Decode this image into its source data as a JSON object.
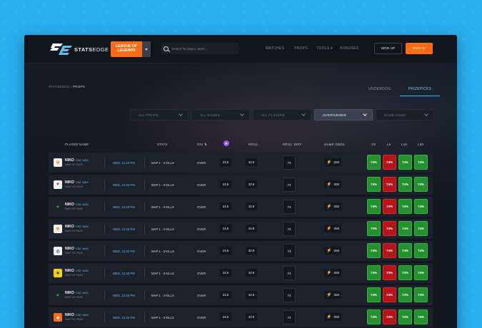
{
  "brand": {
    "name_bold": "STATS",
    "name_light": "EDGE"
  },
  "game_select": {
    "line1": "LEAGUE OF",
    "line2": "LEGENDS"
  },
  "search": {
    "placeholder": "Search for player, team..."
  },
  "nav": {
    "matches": "MATCHES",
    "props": "PROPS",
    "tools": "TOOLS ▾",
    "bonuses": "BONUSES"
  },
  "auth": {
    "signup": "SIGN UP",
    "signin": "SIGN IN"
  },
  "breadcrumb": {
    "root": "STATSEDGE",
    "sep": "/",
    "current": "PROPS"
  },
  "tabs": {
    "underdog": "UNDERDOG",
    "prizepicks": "PRIZEPICKS"
  },
  "filters": [
    "ALL PROPS",
    "ALL GAMES",
    "ALL PLAYERS",
    "OVER/UNDER",
    "GAME ODDS"
  ],
  "headers": {
    "player": "PLAYER NAME",
    "stats": "STATS",
    "ou": "O/U ⇅",
    "pp": "P",
    "proj": "PROJ.",
    "diff": "PROJ. DIFF",
    "odds": "GAME ODDS",
    "vs": "VS",
    "l5": "L5",
    "l10": "L10",
    "l30": "L30"
  },
  "rows": [
    {
      "logo": "navi",
      "name": "NIKO",
      "teams": "C9Z, NAVI",
      "match": "NAVI VS FAZE",
      "time": "WED, 12:20 PM",
      "stat": "MAP 1 - 3 KILLS",
      "ou": "OVER",
      "pp": "24.5",
      "proj": "32.9",
      "diff": "74",
      "odds": "-250",
      "hits": [
        "74%",
        "74%",
        "74%",
        "74%"
      ],
      "hit_colors": [
        "green",
        "red",
        "green",
        "green"
      ]
    },
    {
      "logo": "red",
      "name": "NIKO",
      "teams": "C9Z, NAVI",
      "match": "NAVI VS FAZE",
      "time": "WED, 12:20 PM",
      "stat": "MAP 1 - 3 KILLS",
      "ou": "OVER",
      "pp": "24.5",
      "proj": "32.9",
      "diff": "74",
      "odds": "-250",
      "hits": [
        "74%",
        "74%",
        "74%",
        "74%"
      ],
      "hit_colors": [
        "green",
        "red",
        "green",
        "green"
      ]
    },
    {
      "logo": "green",
      "name": "NIKO",
      "teams": "C9Z, NAVI",
      "match": "NAVI VS FAZE",
      "time": "WED, 12:20 PM",
      "stat": "MAP 1 - 3 KILLS",
      "ou": "OVER",
      "pp": "24.5",
      "proj": "32.9",
      "diff": "74",
      "odds": "-250",
      "hits": [
        "74%",
        "74%",
        "74%",
        "74%"
      ],
      "hit_colors": [
        "green",
        "red",
        "green",
        "green"
      ]
    },
    {
      "logo": "navi",
      "name": "NIKO",
      "teams": "C9Z, NAVI",
      "match": "NAVI VS FAZE",
      "time": "WED, 12:20 PM",
      "stat": "MAP 1 - 3 KILLS",
      "ou": "OVER",
      "pp": "24.5",
      "proj": "32.9",
      "diff": "74",
      "odds": "-250",
      "hits": [
        "74%",
        "74%",
        "74%",
        "74%"
      ],
      "hit_colors": [
        "green",
        "red",
        "green",
        "green"
      ]
    },
    {
      "logo": "purple",
      "name": "NIKO",
      "teams": "C9Z, NAVI",
      "match": "NAVI VS FAZE",
      "time": "WED, 12:20 PM",
      "stat": "MAP 1 - 3 KILLS",
      "ou": "OVER",
      "pp": "24.5",
      "proj": "32.9",
      "diff": "74",
      "odds": "-250",
      "hits": [
        "74%",
        "74%",
        "74%",
        "74%"
      ],
      "hit_colors": [
        "green",
        "red",
        "green",
        "green"
      ]
    },
    {
      "logo": "yellow",
      "name": "NIKO",
      "teams": "C9Z, NAVI",
      "match": "NAVI VS FAZE",
      "time": "WED, 12:20 PM",
      "stat": "MAP 1 - 3 KILLS",
      "ou": "OVER",
      "pp": "24.5",
      "proj": "32.9",
      "diff": "74",
      "odds": "-250",
      "hits": [
        "74%",
        "74%",
        "74%",
        "74%"
      ],
      "hit_colors": [
        "green",
        "red",
        "green",
        "green"
      ]
    },
    {
      "logo": "green",
      "name": "NIKO",
      "teams": "C9Z, NAVI",
      "match": "NAVI VS FAZE",
      "time": "WED, 12:20 PM",
      "stat": "MAP 1 - 3 KILLS",
      "ou": "OVER",
      "pp": "24.5",
      "proj": "32.9",
      "diff": "74",
      "odds": "-250",
      "hits": [
        "74%",
        "74%",
        "74%",
        "74%"
      ],
      "hit_colors": [
        "green",
        "red",
        "green",
        "green"
      ]
    },
    {
      "logo": "orange",
      "name": "NIKO",
      "teams": "C9Z, NAVI",
      "match": "NAVI VS FAZE",
      "time": "WED, 12:20 PM",
      "stat": "MAP 1 - 3 KILLS",
      "ou": "OVER",
      "pp": "24.5",
      "proj": "32.9",
      "diff": "74",
      "odds": "-250",
      "hits": [
        "74%",
        "74%",
        "74%",
        "74%"
      ],
      "hit_colors": [
        "green",
        "red",
        "green",
        "green"
      ]
    }
  ],
  "colors": {
    "accent": "#ff6a13",
    "link": "#5fbdf0",
    "hit_green": "#23912d",
    "hit_red": "#b4141a"
  }
}
